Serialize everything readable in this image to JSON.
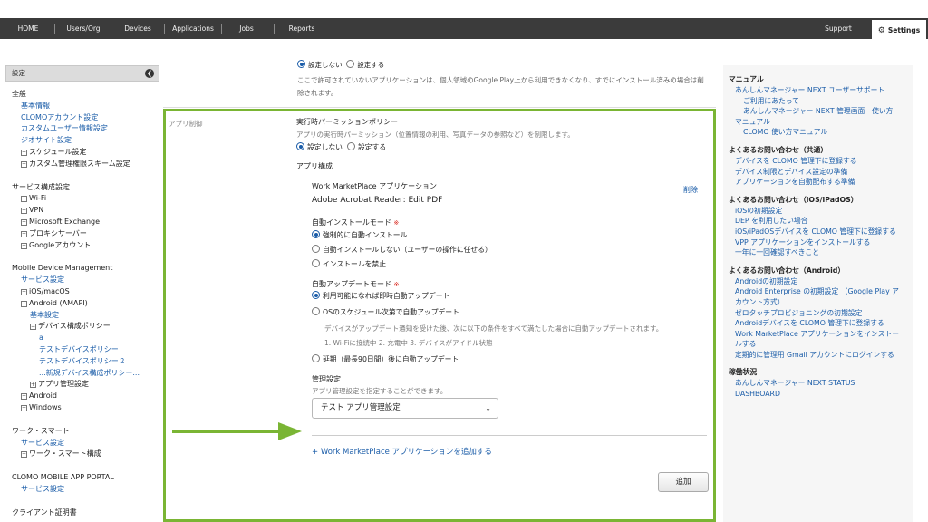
{
  "nav": {
    "items": [
      "HOME",
      "Users/Org",
      "Devices",
      "Applications",
      "Jobs",
      "Reports"
    ],
    "support": "Support",
    "settings": "Settings"
  },
  "sidebar": {
    "header": "設定",
    "sections": [
      {
        "title": "全般",
        "items": [
          {
            "type": "link",
            "label": "基本情報"
          },
          {
            "type": "link",
            "label": "CLOMOアカウント設定"
          },
          {
            "type": "link",
            "label": "カスタムユーザー情報設定"
          },
          {
            "type": "link",
            "label": "ジオサイト設定"
          },
          {
            "type": "tree",
            "label": "スケジュール設定"
          },
          {
            "type": "tree",
            "label": "カスタム管理権限スキーム設定"
          }
        ]
      },
      {
        "title": "サービス構成設定",
        "items": [
          {
            "type": "tree",
            "label": "Wi-Fi"
          },
          {
            "type": "tree",
            "label": "VPN"
          },
          {
            "type": "tree",
            "label": "Microsoft Exchange"
          },
          {
            "type": "tree",
            "label": "プロキシサーバー"
          },
          {
            "type": "tree",
            "label": "Googleアカウント"
          }
        ]
      },
      {
        "title": "Mobile Device Management",
        "items": [
          {
            "type": "link",
            "label": "サービス設定"
          },
          {
            "type": "tree",
            "label": "iOS/macOS"
          },
          {
            "type": "tree-open",
            "label": "Android (AMAPI)"
          },
          {
            "type": "link2",
            "label": "基本設定"
          },
          {
            "type": "tree-open2",
            "label": "デバイス構成ポリシー"
          },
          {
            "type": "link3",
            "label": "a"
          },
          {
            "type": "link3",
            "label": "テストデバイスポリシー"
          },
          {
            "type": "link3",
            "label": "テストデバイスポリシー２"
          },
          {
            "type": "link3",
            "label": "...新規デバイス構成ポリシー..."
          },
          {
            "type": "tree2",
            "label": "アプリ管理設定"
          },
          {
            "type": "tree",
            "label": "Android"
          },
          {
            "type": "tree",
            "label": "Windows"
          }
        ]
      },
      {
        "title": "ワーク・スマート",
        "items": [
          {
            "type": "link",
            "label": "サービス設定"
          },
          {
            "type": "tree",
            "label": "ワーク・スマート構成"
          }
        ]
      },
      {
        "title": "CLOMO MOBILE APP PORTAL",
        "items": [
          {
            "type": "link",
            "label": "サービス設定"
          }
        ]
      },
      {
        "title": "クライアント証明書",
        "items": []
      }
    ]
  },
  "main": {
    "top_radio_on": "設定しない",
    "top_radio_off": "設定する",
    "top_note": "ここで許可されていないアプリケーションは、個人領域のGoogle Play上から利用できなくなり、すでにインストール済みの場合は削除されます。",
    "row_label": "アプリ制御",
    "runtime_policy_title": "実行時パーミッションポリシー",
    "runtime_policy_desc": "アプリの実行時パーミッション（位置情報の利用、写真データの参照など）を制限します。",
    "runtime_radio_on": "設定しない",
    "runtime_radio_off": "設定する",
    "app_config_title": "アプリ構成",
    "wm_app_label": "Work MarketPlace アプリケーション",
    "app_name": "Adobe Acrobat Reader: Edit PDF",
    "delete": "削除",
    "auto_install_title": "自動インストールモード",
    "required_mark": "※",
    "auto_install_options": [
      "強制的に自動インストール",
      "自動インストールしない（ユーザーの操作に任せる）",
      "インストールを禁止"
    ],
    "auto_update_title": "自動アップデートモード",
    "auto_update_opt1": "利用可能になれば即時自動アップデート",
    "auto_update_opt2": "OSのスケジュール次第で自動アップデート",
    "auto_update_note1": "デバイスがアップデート通知を受けた後、次に以下の条件をすべて満たした場合に自動アップデートされます。",
    "auto_update_note2": "1. Wi-Fiに接続中 2. 充電中 3. デバイスがアイドル状態",
    "auto_update_opt3": "延期（最長90日間）後に自動アップデート",
    "mgmt_title": "管理設定",
    "mgmt_desc": "アプリ管理設定を指定することができます。",
    "mgmt_select": "テスト アプリ管理設定",
    "add_app_link": "+ Work MarketPlace アプリケーションを追加する",
    "add_button": "追加"
  },
  "help": {
    "groups": [
      {
        "title": "マニュアル",
        "links": [
          {
            "label": "あんしんマネージャー NEXT ユーザーサポート",
            "indent": 1
          },
          {
            "label": "ご利用にあたって",
            "indent": 2
          },
          {
            "label": "あんしんマネージャー NEXT 管理画面　使い方",
            "indent": 2
          },
          {
            "label": "マニュアル",
            "indent": 1
          },
          {
            "label": "CLOMO 使い方マニュアル",
            "indent": 2
          }
        ]
      },
      {
        "title": "よくあるお問い合わせ（共通）",
        "links": [
          {
            "label": "デバイスを CLOMO 管理下に登録する",
            "indent": 1
          },
          {
            "label": "デバイス制限とデバイス設定の準備",
            "indent": 1
          },
          {
            "label": "アプリケーションを自動配布する準備",
            "indent": 1
          }
        ]
      },
      {
        "title": "よくあるお問い合わせ（iOS/iPadOS）",
        "links": [
          {
            "label": "iOSの初期設定",
            "indent": 1
          },
          {
            "label": "DEP を利用したい場合",
            "indent": 1
          },
          {
            "label": "iOS/iPadOSデバイスを CLOMO 管理下に登録する",
            "indent": 1
          },
          {
            "label": "VPP アプリケーションをインストールする",
            "indent": 1
          },
          {
            "label": "一年に一回確認すべきこと",
            "indent": 1
          }
        ]
      },
      {
        "title": "よくあるお問い合わせ（Android）",
        "links": [
          {
            "label": "Androidの初期設定",
            "indent": 1
          },
          {
            "label": "Android Enterprise の初期設定 （Google Play ア",
            "indent": 1
          },
          {
            "label": "カウント方式）",
            "indent": 1
          },
          {
            "label": "ゼロタッチプロビジョニングの初期設定",
            "indent": 1
          },
          {
            "label": "Androidデバイスを CLOMO 管理下に登録する",
            "indent": 1
          },
          {
            "label": "Work MarketPlace アプリケーションをインストー",
            "indent": 1
          },
          {
            "label": "ルする",
            "indent": 1
          },
          {
            "label": "定期的に管理用 Gmail アカウントにログインする",
            "indent": 1
          }
        ]
      },
      {
        "title": "稼働状況",
        "links": [
          {
            "label": "あんしんマネージャー NEXT STATUS",
            "indent": 1
          },
          {
            "label": "DASHBOARD",
            "indent": 1
          }
        ]
      }
    ]
  },
  "colors": {
    "accent_green": "#7ab534",
    "link_blue": "#1a5ca8",
    "nav_bg": "#3b3b3b",
    "required_red": "#d9261c"
  }
}
